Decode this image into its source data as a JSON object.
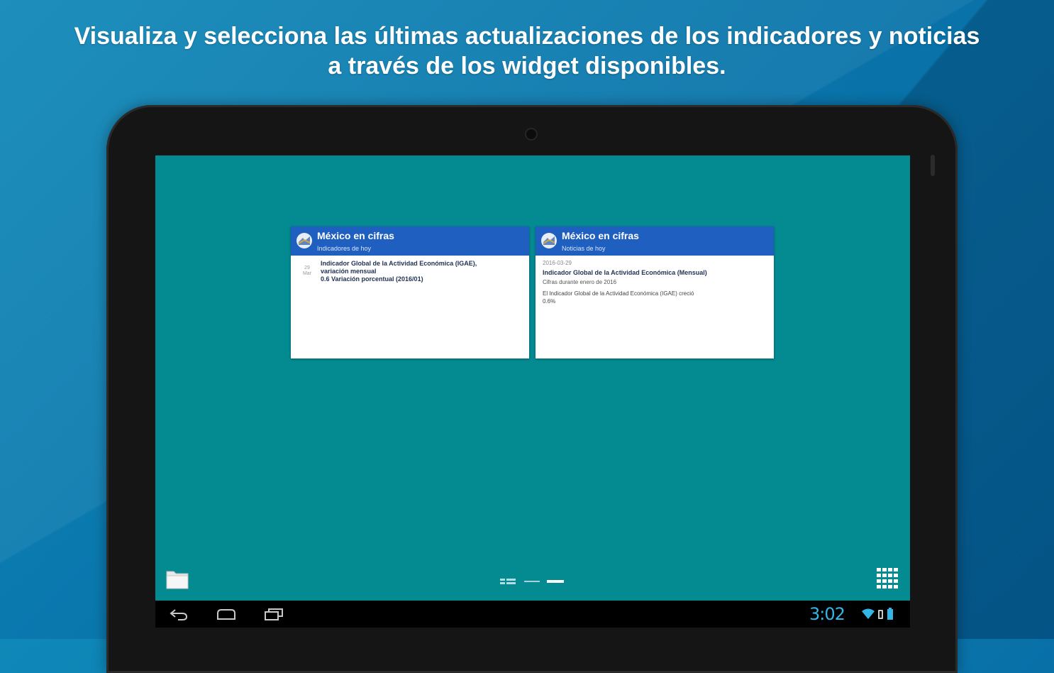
{
  "headline": {
    "line1": "Visualiza y selecciona las últimas actualizaciones de los indicadores y noticias",
    "line2": "a través de los widget disponibles."
  },
  "widgets": [
    {
      "title": "México en cifras",
      "subtitle": "Indicadores de hoy",
      "date_day": "29",
      "date_month": "Mar",
      "line1": "Indicador Global de la Actividad Económica (IGAE),",
      "line2": "variación mensual",
      "line3": "0.6 Variación porcentual (2016/01)"
    },
    {
      "title": "México en cifras",
      "subtitle": "Noticias de hoy",
      "date": "2016-03-29",
      "headline": "Indicador Global de la Actividad Económica (Mensual)",
      "line": "Cifras durante enero de 2016",
      "text1": "El Indicador Global de la Actividad Económica (IGAE) creció",
      "text2": "0.6%"
    }
  ],
  "statusbar": {
    "clock": "3:02"
  },
  "colors": {
    "background": "#0a78ad",
    "screen": "#048a91",
    "widget_header": "#1f5fbf",
    "clock": "#33b5e5"
  },
  "icons": {
    "folder": "folder-icon",
    "apps": "app-grid-icon",
    "back": "back-icon",
    "home": "home-icon",
    "recent": "recent-apps-icon",
    "wifi": "wifi-icon",
    "battery": "battery-icon",
    "signal": "signal-icon"
  }
}
